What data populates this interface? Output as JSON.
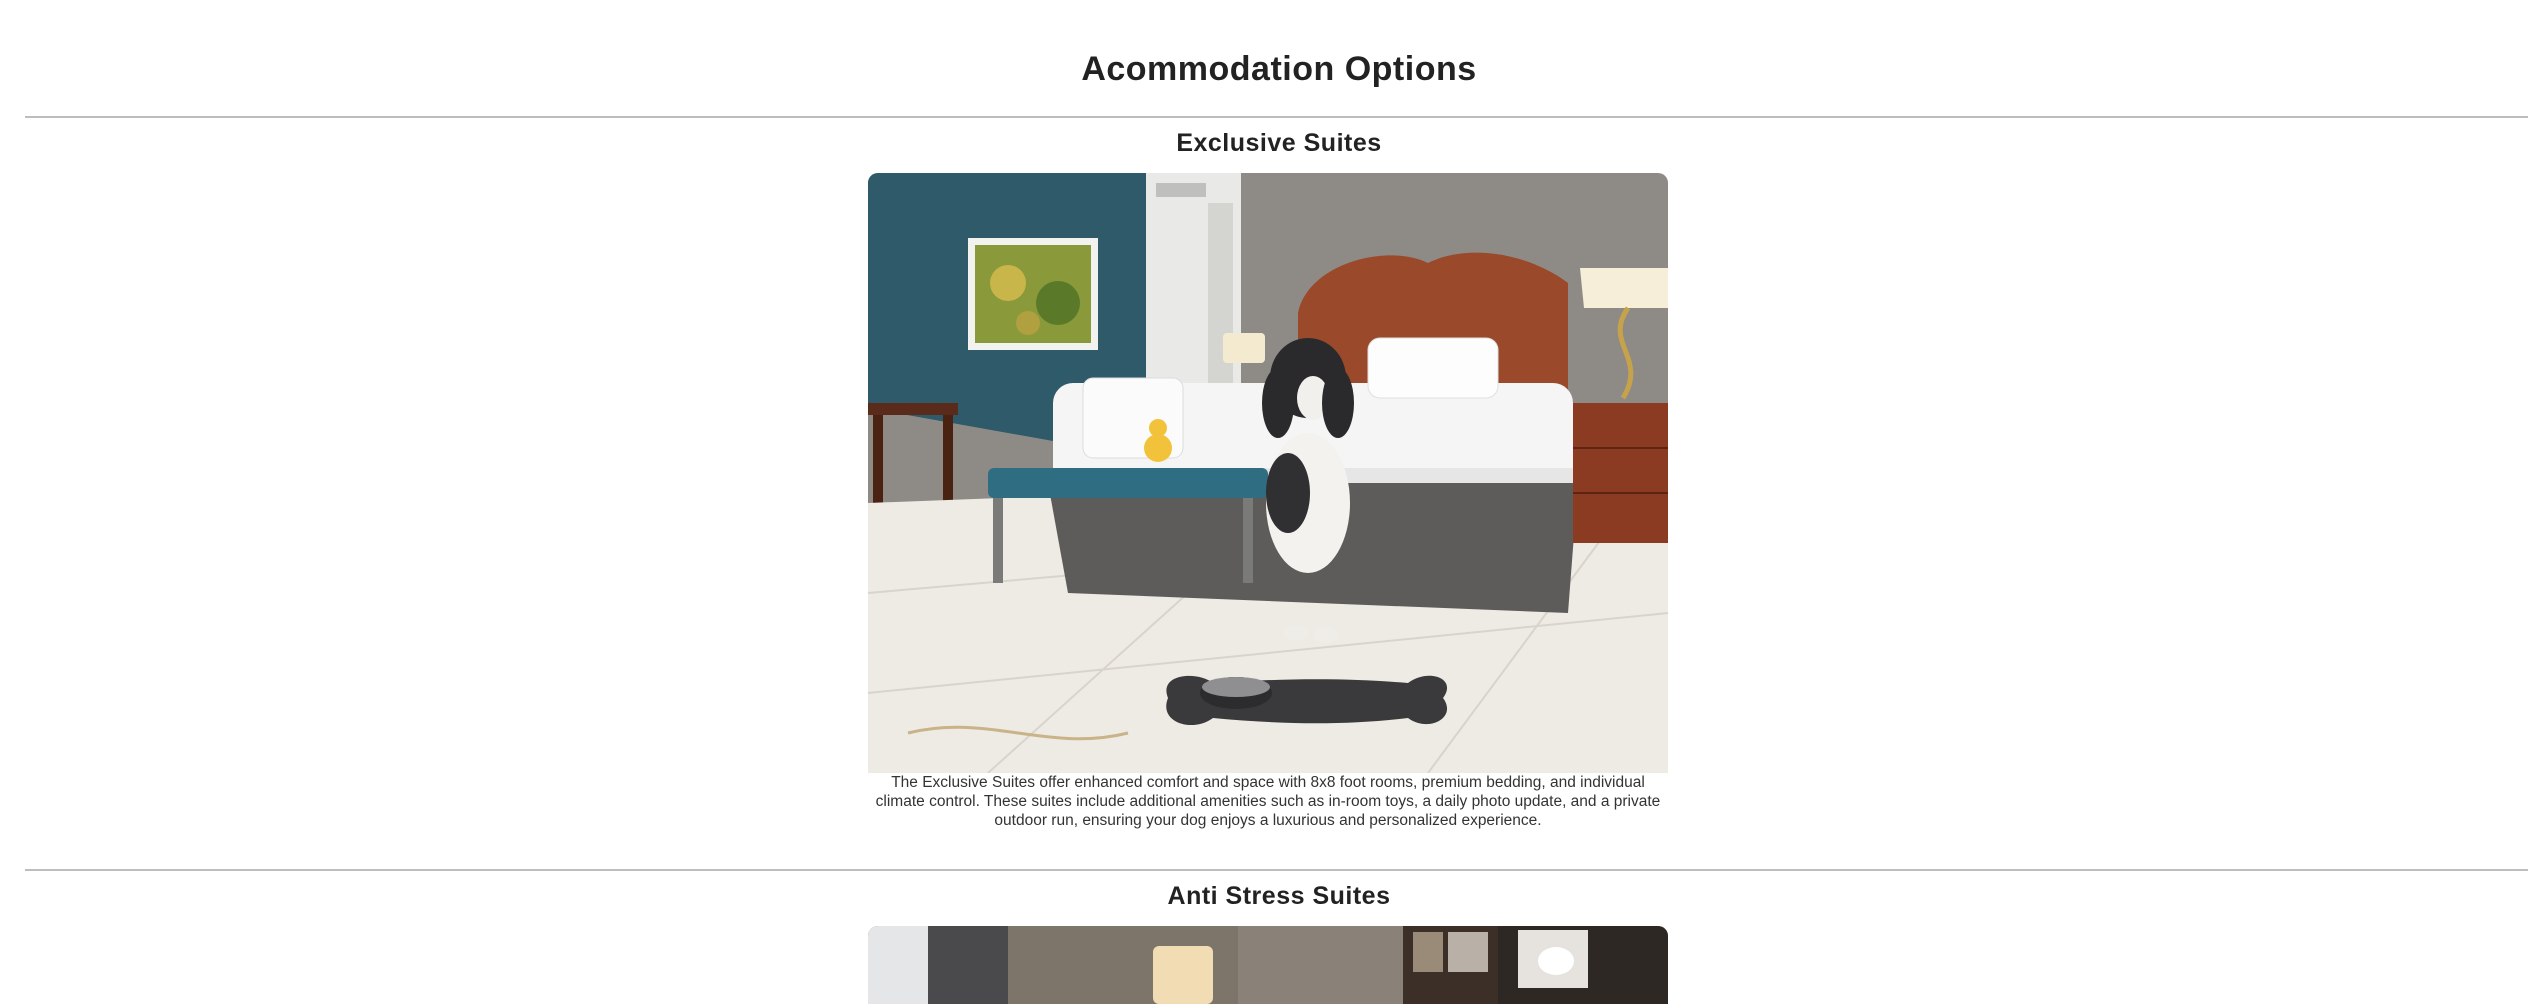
{
  "page": {
    "title": "Acommodation Options"
  },
  "sections": [
    {
      "heading": "Exclusive Suites",
      "image_alt": "dog-in-luxury-suite-photo",
      "description": "The Exclusive Suites offer enhanced comfort and space with 8x8 foot rooms, premium bedding, and individual climate control. These suites include additional amenities such as in-room toys, a daily photo update, and a private outdoor run, ensuring your dog enjoys a luxurious and personalized experience."
    },
    {
      "heading": "Anti Stress Suites",
      "image_alt": "anti-stress-suite-photo"
    }
  ],
  "colors": {
    "text": "#222222",
    "divider": "#bdbdbd",
    "wall_teal": "#2f5b6c",
    "wall_gray": "#8a8885",
    "headboard": "#9a4a2a",
    "floor": "#efece6"
  }
}
